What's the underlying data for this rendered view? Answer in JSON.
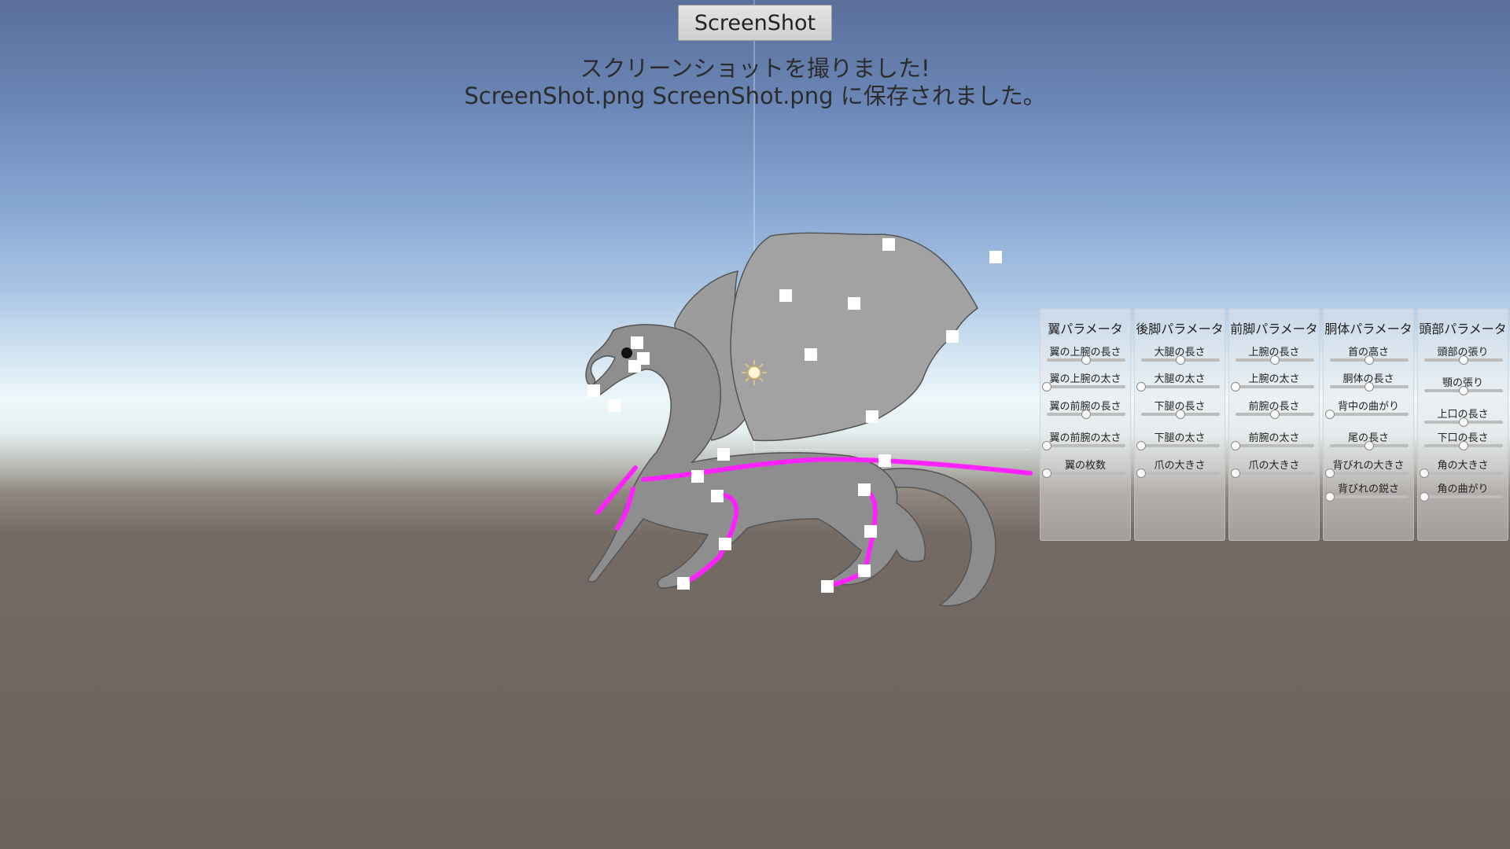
{
  "screenshot_button": {
    "label": "ScreenShot"
  },
  "message": {
    "line1": "スクリーンショットを撮りました!",
    "line2": "ScreenShot.png ScreenShot.png に保存されました。"
  },
  "colors": {
    "bone": "#ff22ff",
    "handle": "#ffffff",
    "dragon": "#8a8a8a",
    "wing": "#9a9a9a"
  },
  "panels": [
    {
      "title": "翼パラメータ",
      "params": [
        {
          "label": "翼の上腕の長さ",
          "value": 0.5
        },
        {
          "label": "翼の上腕の太さ",
          "value": 0.0
        },
        {
          "label": "翼の前腕の長さ",
          "value": 0.5
        },
        {
          "label": "翼の前腕の太さ",
          "value": 0.0
        },
        {
          "label": "翼の枚数",
          "value": 0.0
        }
      ]
    },
    {
      "title": "後脚パラメータ",
      "params": [
        {
          "label": "大腿の長さ",
          "value": 0.5
        },
        {
          "label": "大腿の太さ",
          "value": 0.0
        },
        {
          "label": "下腿の長さ",
          "value": 0.5
        },
        {
          "label": "下腿の太さ",
          "value": 0.0
        },
        {
          "label": "爪の大きさ",
          "value": 0.0
        }
      ]
    },
    {
      "title": "前脚パラメータ",
      "params": [
        {
          "label": "上腕の長さ",
          "value": 0.5
        },
        {
          "label": "上腕の太さ",
          "value": 0.0
        },
        {
          "label": "前腕の長さ",
          "value": 0.5
        },
        {
          "label": "前腕の太さ",
          "value": 0.0
        },
        {
          "label": "爪の大きさ",
          "value": 0.0
        }
      ]
    },
    {
      "title": "胴体パラメータ",
      "params": [
        {
          "label": "首の高さ",
          "value": 0.5
        },
        {
          "label": "胴体の長さ",
          "value": 0.5
        },
        {
          "label": "背中の曲がり",
          "value": 0.0
        },
        {
          "label": "尾の長さ",
          "value": 0.5
        },
        {
          "label": "背びれの大きさ",
          "value": 0.0
        },
        {
          "label": "背びれの鋭さ",
          "value": 0.0
        }
      ]
    },
    {
      "title": "頭部パラメータ",
      "params": [
        {
          "label": "頭部の張り",
          "value": 0.5
        },
        {
          "label": "顎の張り",
          "value": 0.5
        },
        {
          "label": "上口の長さ",
          "value": 0.5
        },
        {
          "label": "下口の長さ",
          "value": 0.5
        },
        {
          "label": "角の大きさ",
          "value": 0.0
        },
        {
          "label": "角の曲がり",
          "value": 0.0
        }
      ]
    }
  ]
}
